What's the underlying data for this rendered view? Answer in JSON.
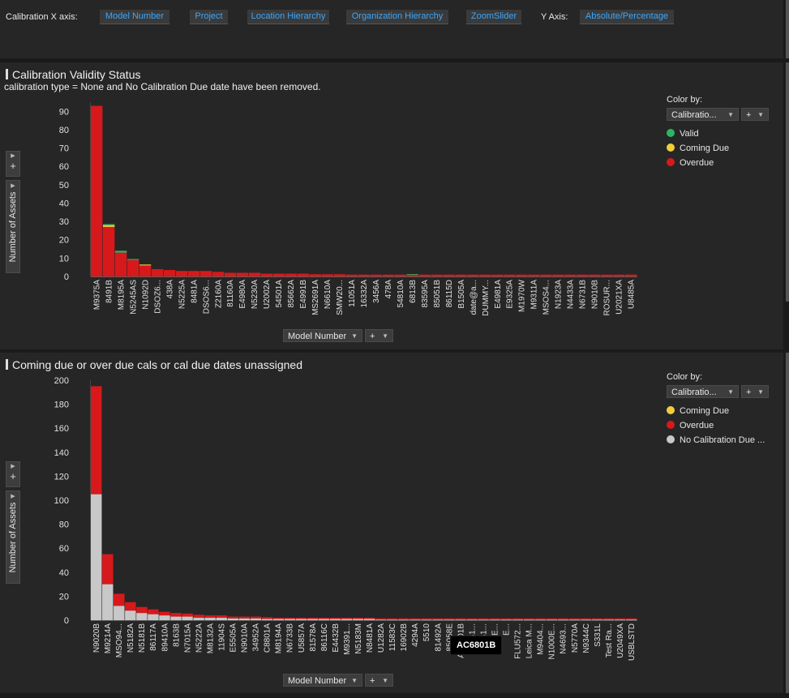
{
  "toolbar": {
    "x_axis_label": "Calibration X axis:",
    "x_buttons": [
      "Model Number",
      "Project",
      "Location Hierarchy",
      "Organization Hierarchy",
      "ZoomSlider"
    ],
    "y_axis_label": "Y Axis:",
    "y_button": "Absolute/Percentage"
  },
  "panel1": {
    "title": "Calibration Validity Status",
    "subtitle": "calibration type = None and No Calibration Due date have been removed.",
    "ylabel": "Number of Assets",
    "axis_selector": "Model Number",
    "color_by_label": "Color by:",
    "color_by_value": "Calibratio...",
    "legend": [
      {
        "label": "Valid",
        "color": "#2db562"
      },
      {
        "label": "Coming Due",
        "color": "#f2cd3b"
      },
      {
        "label": "Overdue",
        "color": "#d7191c"
      }
    ]
  },
  "panel2": {
    "title": "Coming due or over due cals or cal due dates unassigned",
    "ylabel": "Number of Assets",
    "axis_selector": "Model Number",
    "color_by_label": "Color by:",
    "color_by_value": "Calibratio...",
    "legend": [
      {
        "label": "Coming Due",
        "color": "#f2cd3b"
      },
      {
        "label": "Overdue",
        "color": "#d7191c"
      },
      {
        "label": "No Calibration Due ...",
        "color": "#c8c8c8"
      }
    ],
    "tooltip": "AC6801B"
  },
  "icons": {
    "add": "plus-icon",
    "dropdown": "chevron-down-icon",
    "expand": "chevron-right-icon"
  },
  "chart_data": [
    {
      "type": "bar",
      "stacked": true,
      "title": "Calibration Validity Status",
      "subtitle": "calibration type = None and No Calibration Due date have been removed.",
      "xlabel": "Model Number",
      "ylabel": "Number of Assets",
      "ylim": [
        0,
        95
      ],
      "yticks": [
        0,
        10,
        20,
        30,
        40,
        50,
        60,
        70,
        80,
        90
      ],
      "categories": [
        "M9375A",
        "8491B",
        "M8195A",
        "N5245AS",
        "N1092D",
        "DSOZ6...",
        "438A",
        "N5225A",
        "8481A",
        "DSOS6...",
        "Z2160A",
        "81160A",
        "E4980A",
        "N5230A",
        "U2002A",
        "54501A",
        "85662A",
        "E4991B",
        "MS2691A",
        "N6610A",
        "SMW20...",
        "11051A",
        "16332A",
        "3456A",
        "478A",
        "54810A",
        "6813B",
        "83595A",
        "85051B",
        "86115D",
        "B1505A",
        "date@a...",
        "DUMMY...",
        "E4981A",
        "E9325A",
        "M1970W",
        "M9311A",
        "MSOS4...",
        "N1923A",
        "N4433A",
        "N6731B",
        "N9010B",
        "ROSUR...",
        "U2021XA",
        "U8485A"
      ],
      "series": [
        {
          "name": "Overdue",
          "color": "#d7191c",
          "values": [
            93,
            27,
            13,
            9,
            6,
            4,
            3.5,
            3,
            3,
            3,
            2.5,
            2,
            2,
            2,
            1.5,
            1.5,
            1.5,
            1.5,
            1.2,
            1.2,
            1.2,
            1,
            1,
            1,
            1,
            1,
            1,
            1,
            1,
            1,
            1,
            1,
            1,
            1,
            1,
            1,
            1,
            1,
            1,
            1,
            1,
            1,
            1,
            1,
            1
          ]
        },
        {
          "name": "Coming Due",
          "color": "#f2cd3b",
          "values": [
            0,
            1,
            0,
            0,
            0.5,
            0,
            0,
            0,
            0,
            0,
            0,
            0,
            0,
            0,
            0,
            0,
            0,
            0,
            0,
            0,
            0,
            0,
            0,
            0,
            0,
            0,
            0,
            0,
            0,
            0,
            0,
            0,
            0,
            0,
            0,
            0,
            0,
            0,
            0,
            0,
            0,
            0,
            0,
            0,
            0
          ]
        },
        {
          "name": "Valid",
          "color": "#2db562",
          "values": [
            0,
            0.5,
            1,
            0.5,
            0,
            0,
            0,
            0,
            0,
            0,
            0,
            0,
            0,
            0,
            0,
            0,
            0,
            0,
            0,
            0,
            0,
            0,
            0,
            0,
            0,
            0,
            0.3,
            0,
            0,
            0,
            0,
            0,
            0,
            0,
            0,
            0,
            0,
            0,
            0,
            0,
            0,
            0,
            0,
            0,
            0
          ]
        }
      ],
      "legend_position": "right"
    },
    {
      "type": "bar",
      "stacked": true,
      "title": "Coming due or over due cals or cal due dates unassigned",
      "xlabel": "Model Number",
      "ylabel": "Number of Assets",
      "ylim": [
        0,
        200
      ],
      "yticks": [
        0,
        20,
        40,
        60,
        80,
        100,
        120,
        140,
        160,
        180,
        200
      ],
      "categories": [
        "N9020B",
        "M9214A",
        "MSO94...",
        "N5182A",
        "N5181B",
        "86117A",
        "89410A",
        "8163B",
        "N7015A",
        "N5222A",
        "M8132A",
        "11904S",
        "E5505A",
        "N9010A",
        "34952A",
        "C8801A",
        "M8194A",
        "N6733B",
        "U5857A",
        "81578A",
        "86116C",
        "E4432B",
        "M9391...",
        "N5183M",
        "N8481A",
        "U1282A",
        "11583C",
        "16902B",
        "4294A",
        "5510",
        "81492A",
        "85058E",
        "AC6801B",
        "B1...",
        "B1...",
        "E...",
        "E...",
        "FLU572...",
        "Leica M...",
        "M9404...",
        "N1000E...",
        "N4693...",
        "N5770A",
        "N9344C",
        "S331L",
        "Test Ra...",
        "U2049XA",
        "USBLSTD"
      ],
      "series": [
        {
          "name": "No Calibration Due ...",
          "color": "#c8c8c8",
          "values": [
            105,
            30,
            12,
            8,
            6,
            5,
            4,
            3,
            3,
            2,
            2,
            2,
            1.5,
            1.5,
            1.5,
            1,
            1,
            1,
            1,
            1,
            1,
            1,
            1,
            1,
            1,
            0.5,
            0.5,
            0.5,
            0.5,
            0.5,
            0.5,
            0.5,
            0.5,
            0.5,
            0.5,
            0.5,
            0.5,
            0.5,
            0.5,
            0.5,
            0.5,
            0.5,
            0.5,
            0.5,
            0.5,
            0.5,
            0.5,
            0.5
          ]
        },
        {
          "name": "Overdue",
          "color": "#d7191c",
          "values": [
            90,
            25,
            10,
            7,
            5,
            4,
            3,
            3,
            2.5,
            2.5,
            2,
            2,
            1.5,
            1.5,
            1.5,
            1.5,
            1,
            1,
            1,
            1,
            1,
            1,
            1,
            1,
            1,
            1,
            1,
            1,
            1,
            1,
            1,
            1,
            1,
            1,
            1,
            1,
            1,
            1,
            1,
            1,
            1,
            1,
            1,
            1,
            1,
            1,
            1,
            1
          ]
        },
        {
          "name": "Coming Due",
          "color": "#f2cd3b",
          "values": [
            0,
            0,
            0,
            0,
            0,
            0,
            0,
            0,
            0,
            0,
            0,
            0,
            0,
            0,
            0,
            0,
            0,
            0,
            0,
            0,
            0,
            0,
            0,
            0,
            0,
            0,
            0,
            0,
            0,
            0,
            0,
            0,
            0,
            0,
            0,
            0,
            0,
            0,
            0,
            0,
            0,
            0,
            0,
            0,
            0,
            0,
            0,
            0
          ]
        }
      ],
      "legend_position": "right"
    }
  ]
}
